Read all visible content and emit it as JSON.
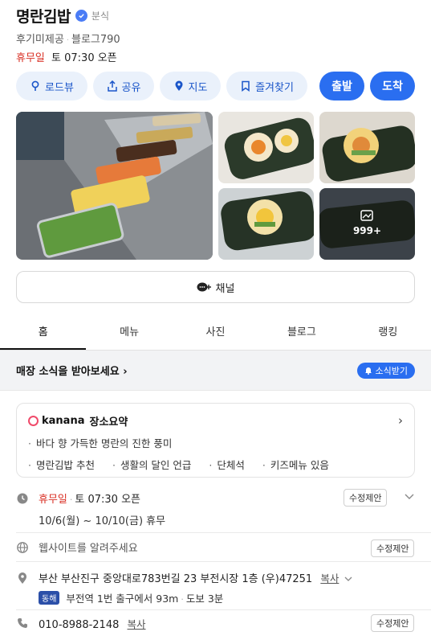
{
  "header": {
    "title": "명란김밥",
    "category": "분식",
    "review_text": "후기미제공",
    "blog_label": "블로그",
    "blog_count": "790",
    "status_closed": "휴무일",
    "status_open": "토 07:30 오픈"
  },
  "actions": {
    "roadview": "로드뷰",
    "share": "공유",
    "map": "지도",
    "favorite": "즐겨찾기",
    "depart": "출발",
    "arrive": "도착"
  },
  "gallery": {
    "more_count": "999+"
  },
  "channel": {
    "label": "채널"
  },
  "tabs": [
    "홈",
    "메뉴",
    "사진",
    "블로그",
    "랭킹"
  ],
  "news": {
    "title": "매장 소식을 받아보세요",
    "button": "소식받기"
  },
  "summary": {
    "brand": "kanana",
    "label": "장소요약",
    "line1": [
      "바다 향 가득한 명란의 진한 풍미"
    ],
    "line2": [
      "명란김밥 추천",
      "생활의 달인 언급",
      "단체석",
      "키즈메뉴 있음"
    ]
  },
  "hours": {
    "closed": "휴무일",
    "open": "토 07:30 오픈",
    "holiday": "10/6(월) ~ 10/10(금) 휴무",
    "suggest": "수정제안"
  },
  "website": {
    "text": "웹사이트를 알려주세요",
    "suggest": "수정제안"
  },
  "address": {
    "text": "부산 부산진구 중앙대로783번길 23 부전시장 1층 (우)47251",
    "copy": "복사",
    "exit_badge": "동해",
    "directions": "부전역 1번 출구에서 93m",
    "walk": "도보 3분"
  },
  "phone": {
    "number": "010-8988-2148",
    "copy": "복사",
    "suggest": "수정제안"
  },
  "colors": {
    "accent": "#2a6ef0",
    "closed": "#d93025",
    "pill_bg": "#eaf1fb"
  }
}
